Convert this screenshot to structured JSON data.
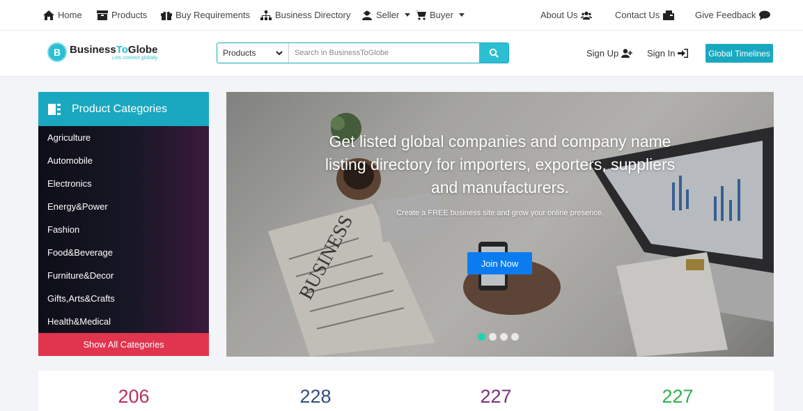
{
  "topnav": {
    "home": "Home",
    "products": "Products",
    "buy_requirements": "Buy Requirements",
    "business_directory": "Business Directory",
    "seller": "Seller",
    "buyer": "Buyer",
    "about_us": "About Us",
    "contact_us": "Contact Us",
    "give_feedback": "Give Feedback"
  },
  "header": {
    "logo_business": "Business",
    "logo_to": "To",
    "logo_globe": "Globe",
    "logo_tagline": "Lets connect globally",
    "search_category": "Products",
    "search_placeholder": "Search in BusinessToGlobe",
    "sign_up": "Sign Up",
    "sign_in": "Sign In",
    "global_timelines": "Global Timelines"
  },
  "sidebar": {
    "title": "Product Categories",
    "items": [
      "Agriculture",
      "Automobile",
      "Electronics",
      "Energy&Power",
      "Fashion",
      "Food&Beverage",
      "Furniture&Decor",
      "Gifts,Arts&Crafts",
      "Health&Medical"
    ],
    "show_all": "Show All Categories"
  },
  "banner": {
    "title": "Get listed global companies and company name listing directory for importers, exporters, suppliers and manufacturers.",
    "subtitle": "Create a FREE business site and grow your online presence.",
    "join_now": "Join Now",
    "slide_count": 4,
    "active_slide": 1
  },
  "stats": [
    {
      "value": "206",
      "color": "#b8325a"
    },
    {
      "value": "228",
      "color": "#2f4f7a"
    },
    {
      "value": "227",
      "color": "#7b2f7e"
    },
    {
      "value": "227",
      "color": "#2fb04a"
    }
  ],
  "colors": {
    "accent": "#1aa8c0",
    "join_button": "#0b7cf0",
    "show_all": "#e0344f",
    "active_dot": "#1fd3b0"
  }
}
